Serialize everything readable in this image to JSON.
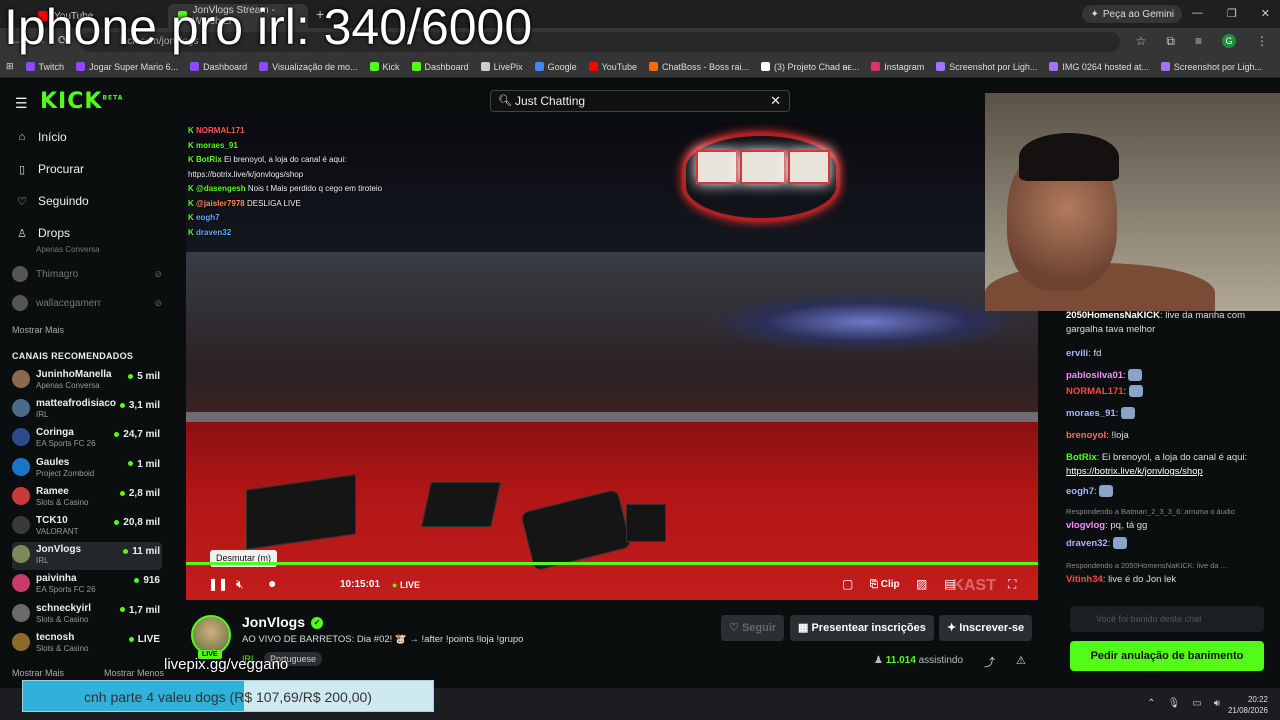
{
  "overlay": {
    "title": "Iphone pro irl: 340/6000",
    "livepix_url": "livepix.gg/veggano"
  },
  "browser": {
    "tabs": [
      {
        "label": "YouTube",
        "fav": "youtube"
      },
      {
        "label": "JonVlogs Stream - Watch Li",
        "fav": "kick"
      }
    ],
    "gemini": "Peça ao Gemini",
    "address": "kick.com/jonvlogs",
    "profile_initial": "G",
    "bookmarks": [
      {
        "label": "Twitch",
        "color": "#9146ff"
      },
      {
        "label": "Jogar Super Mario 6...",
        "color": "#9146ff"
      },
      {
        "label": "Dashboard",
        "color": "#9146ff"
      },
      {
        "label": "Visualização de mo...",
        "color": "#9146ff"
      },
      {
        "label": "Kick",
        "color": "#53fc18"
      },
      {
        "label": "Dashboard",
        "color": "#53fc18"
      },
      {
        "label": "LivePix",
        "color": "#cccccc"
      },
      {
        "label": "Google",
        "color": "#4285f4"
      },
      {
        "label": "YouTube",
        "color": "#ff0000"
      },
      {
        "label": "ChatBoss - Boss rai...",
        "color": "#ff6b00"
      },
      {
        "label": "(3) Projeto Chad ᴃᴇ...",
        "color": "#ffffff"
      },
      {
        "label": "Instagram",
        "color": "#e1306c"
      },
      {
        "label": "Screenshot por Ligh...",
        "color": "#a074ff"
      },
      {
        "label": "IMG 0264 hosted at...",
        "color": "#a074ff"
      },
      {
        "label": "Screenshot por Ligh...",
        "color": "#a074ff"
      }
    ]
  },
  "kick": {
    "logo": "KICK",
    "beta": "BETA",
    "search_value": "Just Chatting"
  },
  "sidebar": {
    "nav": [
      {
        "label": "Início",
        "icon": "home-icon"
      },
      {
        "label": "Procurar",
        "icon": "browse-icon"
      },
      {
        "label": "Seguindo",
        "icon": "heart-icon"
      },
      {
        "label": "Drops",
        "icon": "drops-icon"
      }
    ],
    "following_partial": "Apenas Conversa",
    "following": [
      {
        "name": "Thimagro"
      },
      {
        "name": "wallacegamerr"
      }
    ],
    "show_more": "Mostrar Mais",
    "rec_header": "CANAIS RECOMENDADOS",
    "recommended": [
      {
        "name": "JuninhoManella",
        "category": "Apenas Conversa",
        "viewers": "5 mil",
        "color": "#8a6a4a"
      },
      {
        "name": "matteafrodisiaco",
        "category": "IRL",
        "viewers": "3,1 mil",
        "color": "#4a6a8a"
      },
      {
        "name": "Coringa",
        "category": "EA Sports FC 26",
        "viewers": "24,7 mil",
        "color": "#2d4a8a"
      },
      {
        "name": "Gaules",
        "category": "Project Zomboid",
        "viewers": "1 mil",
        "color": "#1a75c8"
      },
      {
        "name": "Ramee",
        "category": "Slots & Casino",
        "viewers": "2,8 mil",
        "color": "#c83a3a"
      },
      {
        "name": "TCK10",
        "category": "VALORANT",
        "viewers": "20,8 mil",
        "color": "#3a3a3a"
      },
      {
        "name": "JonVlogs",
        "category": "IRL",
        "viewers": "11 mil",
        "color": "#7a8a5a"
      },
      {
        "name": "paivinha",
        "category": "EA Sports FC 26",
        "viewers": "916",
        "color": "#c83a6a"
      },
      {
        "name": "schneckyirl",
        "category": "Slots & Casino",
        "viewers": "1,7 mil",
        "color": "#6a6a6a"
      },
      {
        "name": "tecnosh",
        "category": "Slots & Casino",
        "viewers": "LIVE",
        "color": "#8a6a2a"
      }
    ],
    "show_more_2": "Mostrar Mais",
    "show_less": "Mostrar Menos"
  },
  "video": {
    "overlay_chat": [
      {
        "user": "NORMAL171",
        "text": "",
        "color": "#ff5555"
      },
      {
        "user": "moraes_91",
        "text": "",
        "color": "#53fc18"
      },
      {
        "user": "BotRix",
        "text": "Ei brenoyol, a loja do canal é aqui: https://botrix.live/k/jonvlogs/shop",
        "color": "#53fc18"
      },
      {
        "user": "@dasengesh",
        "text": "Nois t Mais perdido q cego em tiroteio",
        "color": "#53fc18"
      },
      {
        "user": "@jaisler7978",
        "text": "DESLIGA LIVE",
        "color": "#ff8855"
      },
      {
        "user": "eogh7",
        "text": "",
        "color": "#55aaff"
      },
      {
        "user": "draven32",
        "text": "",
        "color": "#55aaff"
      }
    ],
    "tooltip": "Desmutar (m)",
    "time": "10:15:01",
    "live": "LIVE",
    "clip": "Clip",
    "watermark": "KAST"
  },
  "chat": {
    "messages": [
      {
        "user": "2050HomensNaKICK",
        "text": "live da manha com gargalha tava melhor",
        "color": "#ffffff"
      },
      {
        "user": "ervili",
        "text": "fd",
        "color": "#aab4ff"
      },
      {
        "user": "pablosilva01",
        "text": "",
        "color": "#ff88ff"
      },
      {
        "user": "NORMAL171",
        "text": "",
        "color": "#ff4444"
      },
      {
        "user": "moraes_91",
        "text": "",
        "color": "#aab4ff"
      },
      {
        "user": "brenoyol",
        "text": "!loja",
        "color": "#ff6666"
      },
      {
        "user": "BotRix",
        "text": "Ei brenoyol, a loja do canal é aqui:",
        "link": "https://botrix.live/k/jonvlogs/shop",
        "color": "#53fc18"
      },
      {
        "user": "eogh7",
        "text": "",
        "color": "#aab4ff"
      },
      {
        "reply": "Respondendo a Batman_2_3_3_6: arruma o áudio",
        "user": "vlogvlog",
        "text": "pq, tá gg",
        "color": "#ff88ff"
      },
      {
        "user": "draven32",
        "text": "",
        "color": "#aab4ff"
      },
      {
        "reply": "Respondendo a 2050HomensNaKICK: live da ...",
        "user": "Vitinh34",
        "text": "live é do Jon lek",
        "color": "#ff4444"
      }
    ],
    "input_placeholder": "Você foi banido deste chat",
    "ban_button": "Pedir anulação de banimento"
  },
  "stream": {
    "name": "JonVlogs",
    "title": "AO VIVO DE BARRETOS: Dia #02! 🐮 → !after !points !loja !grupo",
    "category": "IRL",
    "language": "Portuguese",
    "live_badge": "LIVE",
    "follow": "Seguir",
    "gift": "Presentear inscrições",
    "subscribe": "Inscrever-se",
    "viewers": "11.014",
    "viewers_label": "assistindo"
  },
  "livepix": {
    "text": "cnh parte 4 valeu dogs (R$ 107,69/R$ 200,00)",
    "progress": 0.538
  },
  "taskbar": {
    "time": "20:22",
    "date": "21/08/2026"
  }
}
